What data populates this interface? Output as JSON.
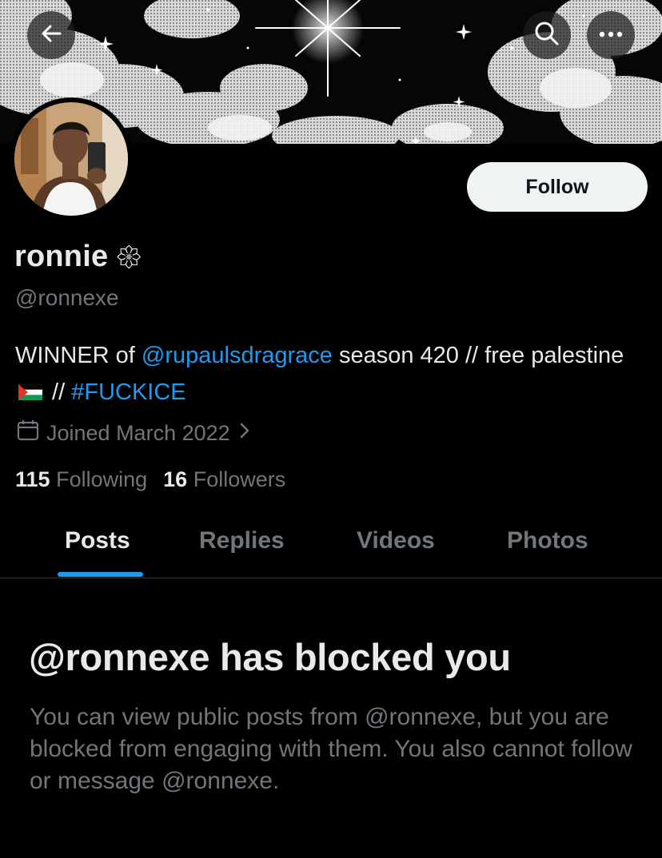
{
  "header": {
    "back_icon": "arrow-left-icon",
    "search_icon": "search-icon",
    "more_icon": "more-horizontal-icon"
  },
  "profile": {
    "name": "ronnie",
    "name_emoji": "𑁍",
    "handle": "@ronnexe",
    "follow_label": "Follow",
    "bio": {
      "prefix": "WINNER of ",
      "mention": "@rupaulsdragrace",
      "middle": " season 420 // free palestine ",
      "sep": " // ",
      "hashtag": "#FUCKICE"
    },
    "joined": "Joined March 2022",
    "following_count": "115",
    "following_label": "Following",
    "followers_count": "16",
    "followers_label": "Followers"
  },
  "tabs": [
    {
      "label": "Posts",
      "active": true
    },
    {
      "label": "Replies",
      "active": false
    },
    {
      "label": "Videos",
      "active": false
    },
    {
      "label": "Photos",
      "active": false
    }
  ],
  "blocked": {
    "title": "@ronnexe has blocked you",
    "body": "You can view public posts from @ronnexe, but you are blocked from engaging with them. You also cannot follow or message @ronnexe."
  },
  "colors": {
    "accent": "#1d9bf0",
    "background": "#000000",
    "secondary_text": "#71767b"
  }
}
